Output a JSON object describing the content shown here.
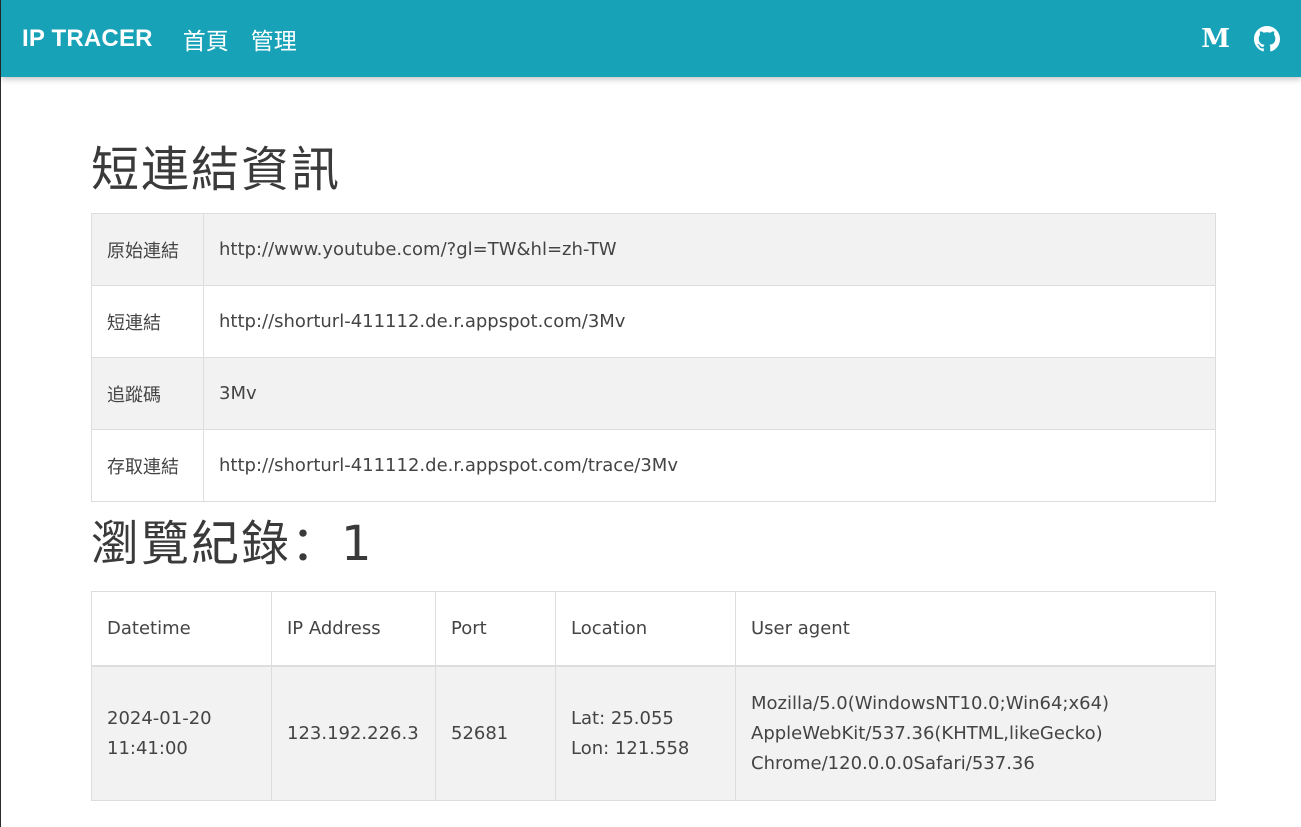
{
  "navbar": {
    "brand": "IP TRACER",
    "links": [
      "首頁",
      "管理"
    ],
    "medium_label": "M",
    "icons": [
      "medium-icon",
      "github-icon"
    ],
    "color": "#17a2b8"
  },
  "info": {
    "title": "短連結資訊",
    "rows": [
      {
        "label": "原始連結",
        "value": "http://www.youtube.com/?gl=TW&hl=zh-TW"
      },
      {
        "label": "短連結",
        "value": "http://shorturl-411112.de.r.appspot.com/3Mv"
      },
      {
        "label": "追蹤碼",
        "value": "3Mv"
      },
      {
        "label": "存取連結",
        "value": "http://shorturl-411112.de.r.appspot.com/trace/3Mv"
      }
    ]
  },
  "logs": {
    "title": "瀏覽紀錄：1",
    "columns": [
      "Datetime",
      "IP Address",
      "Port",
      "Location",
      "User agent"
    ],
    "rows": [
      {
        "datetime_date": "2024-01-20",
        "datetime_time": "11:41:00",
        "ip": "123.192.226.3",
        "port": "52681",
        "lat": "Lat: 25.055",
        "lon": "Lon: 121.558",
        "ua_line1": "Mozilla/5.0(WindowsNT10.0;Win64;x64)",
        "ua_line2": "AppleWebKit/537.36(KHTML,likeGecko)",
        "ua_line3": "Chrome/120.0.0.0Safari/537.36"
      }
    ]
  }
}
